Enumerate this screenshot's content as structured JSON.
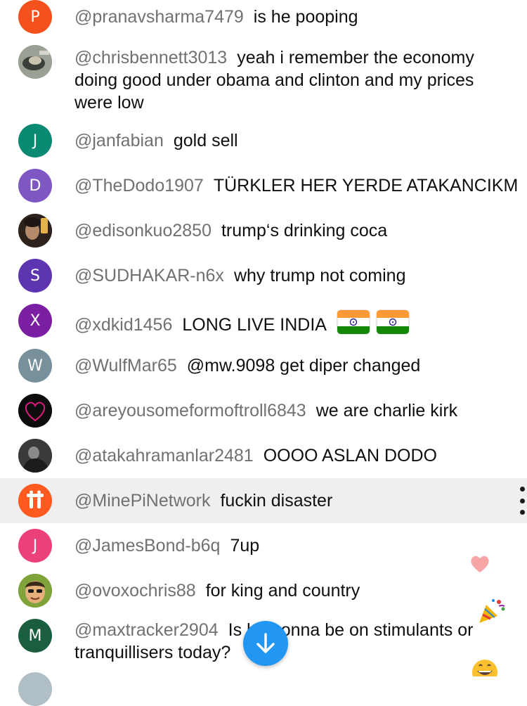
{
  "messages": [
    {
      "author": "@pranavsharma7479",
      "text": "is he pooping",
      "avatar_letter": "P",
      "avatar_color": "#f4511e"
    },
    {
      "author": "@chrisbennett3013",
      "text": "yeah i remember the economy doing good under obama and clinton and my prices were low"
    },
    {
      "author": "@janfabian",
      "text": "gold sell",
      "avatar_letter": "J",
      "avatar_color": "#0b8a73"
    },
    {
      "author": "@TheDodo1907",
      "text": "TÜRKLER HER YERDE ATAKANCIKM",
      "avatar_letter": "D",
      "avatar_color": "#7e57c2"
    },
    {
      "author": "@edisonkuo2850",
      "text": "trump‘s drinking coca"
    },
    {
      "author": "@SUDHAKAR-n6x",
      "text": "why trump not coming",
      "avatar_letter": "S",
      "avatar_color": "#5e35b1"
    },
    {
      "author": "@xdkid1456",
      "text": "LONG LIVE INDIA",
      "avatar_letter": "X",
      "avatar_color": "#7b1fa2"
    },
    {
      "author": "@WulfMar65",
      "text": "@mw.9098 get diper changed",
      "avatar_letter": "W",
      "avatar_color": "#78909c"
    },
    {
      "author": "@areyousomeformoftroll6843",
      "text": "we are charlie kirk"
    },
    {
      "author": "@atakahramanlar2481",
      "text": "OOOO ASLAN DODO"
    },
    {
      "author": "@MinePiNetwork",
      "text": "fuckin disaster"
    },
    {
      "author": "@JamesBond-b6q",
      "text": "7up",
      "avatar_letter": "J",
      "avatar_color": "#ec407a"
    },
    {
      "author": "@ovoxochris88",
      "text": "for king and country"
    },
    {
      "author": "@maxtracker2904",
      "text": "Is he gonna be on stimulants or tranquillisers today?",
      "avatar_letter": "M",
      "avatar_color": "#1b5e3f"
    }
  ],
  "icons": {
    "minepi": "pi-network-logo-icon",
    "flag": "india-flag-icon",
    "more": "more-vertical-icon",
    "scroll": "arrow-down-icon",
    "reactions": [
      "heart-reaction-icon",
      "party-popper-reaction-icon",
      "grinning-face-reaction-icon"
    ]
  },
  "colors": {
    "author": "#717171",
    "highlight": "#efefef",
    "scroll_button": "#2196f3",
    "minepi": "#ff5a1f"
  }
}
